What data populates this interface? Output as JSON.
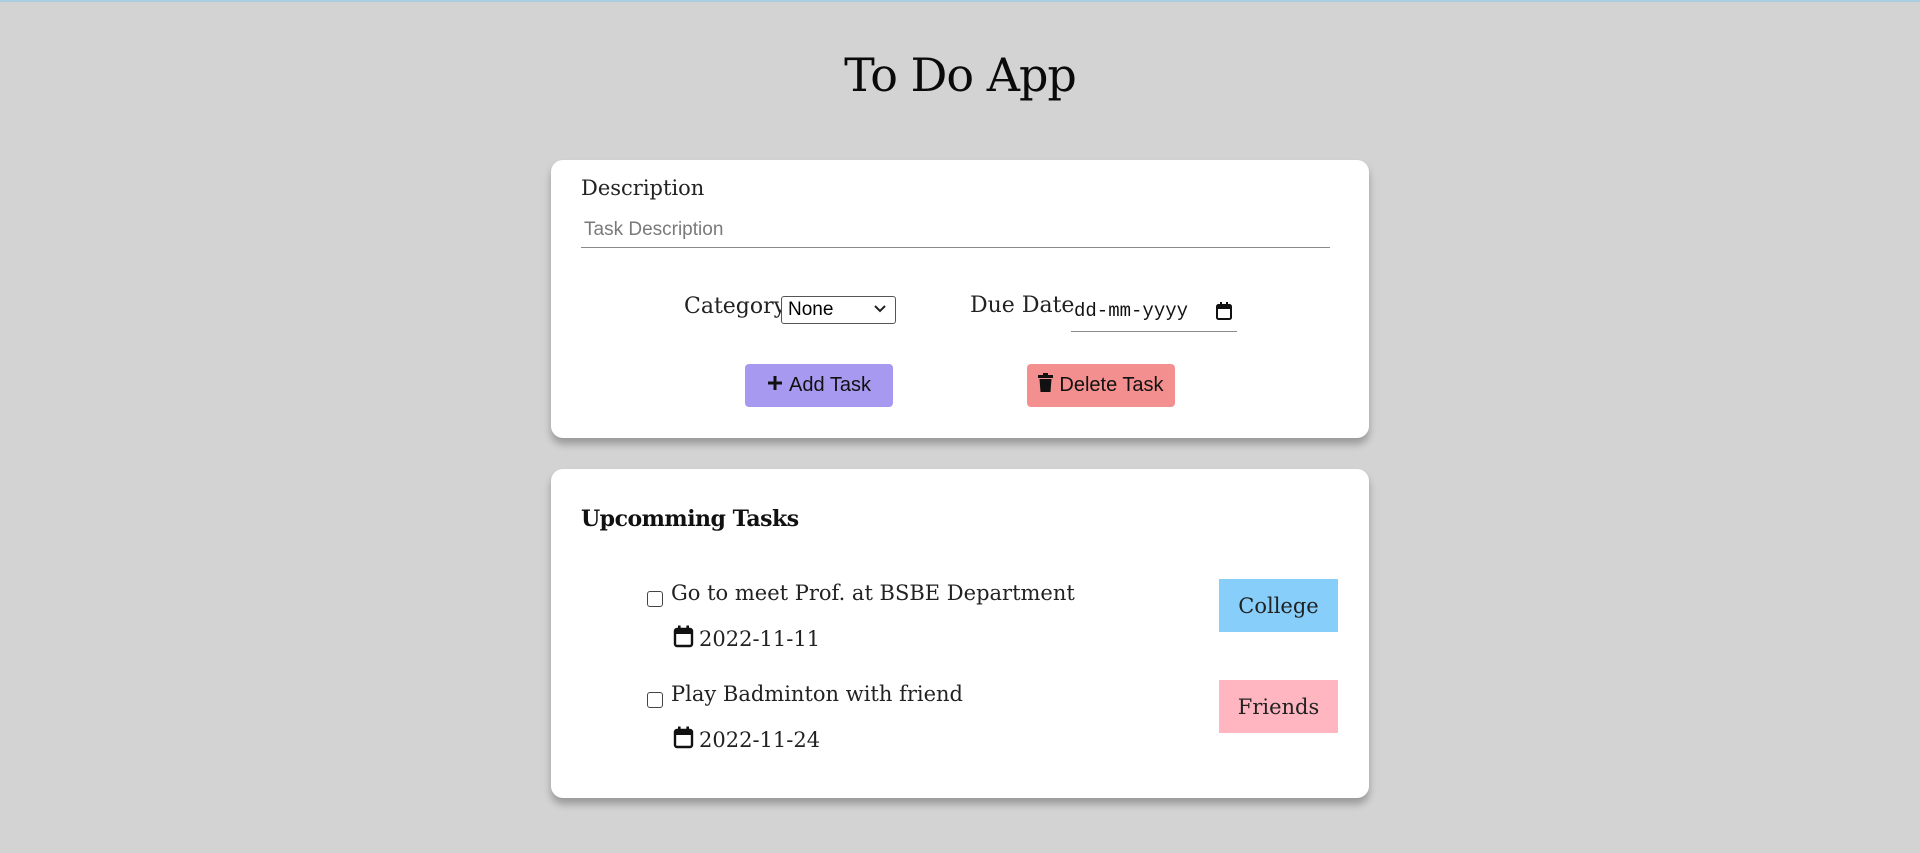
{
  "app": {
    "title": "To Do App"
  },
  "form": {
    "description_label": "Description",
    "description_placeholder": "Task Description",
    "description_value": "",
    "category_label": "Category",
    "category_selected": "None",
    "due_date_label": "Due Date",
    "due_date_placeholder": "dd-mm-yyyy",
    "add_button_label": "Add Task",
    "add_button_icon": "plus-icon",
    "delete_button_label": "Delete Task",
    "delete_button_icon": "trash-icon",
    "add_button_color": "#a699ef",
    "delete_button_color": "#f48f8f"
  },
  "tasks": {
    "heading": "Upcomming Tasks",
    "items": [
      {
        "description": "Go to meet Prof. at BSBE Department",
        "due_date": "2022-11-11",
        "category": "College",
        "category_color": "#87cefa",
        "checked": false
      },
      {
        "description": "Play Badminton with friend",
        "due_date": "2022-11-24",
        "category": "Friends",
        "category_color": "#ffb6c1",
        "checked": false
      }
    ]
  },
  "colors": {
    "background": "#d3d3d3",
    "card": "#ffffff"
  }
}
